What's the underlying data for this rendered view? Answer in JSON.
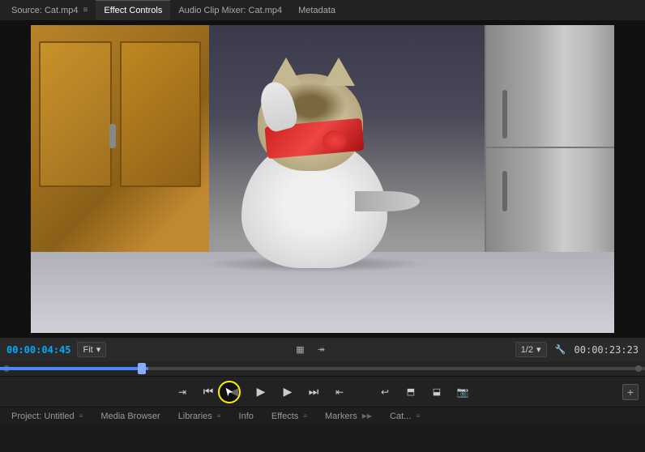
{
  "tabs": {
    "source": {
      "label": "Source: Cat.mp4",
      "menu_icon": "≡"
    },
    "effect_controls": {
      "label": "Effect Controls"
    },
    "audio_mixer": {
      "label": "Audio Clip Mixer: Cat.mp4"
    },
    "metadata": {
      "label": "Metadata"
    }
  },
  "player": {
    "current_time": "00:00:04:45",
    "total_time": "00:00:23:23",
    "fit_label": "Fit",
    "ratio_label": "1/2",
    "fit_arrow": "▾",
    "ratio_arrow": "▾"
  },
  "playback_controls": {
    "step_back_label": "◀◀",
    "frame_back_label": "◀",
    "play_label": "▶",
    "frame_fwd_label": "▶",
    "step_fwd_label": "▶▶",
    "in_point_label": "⇥",
    "out_point_label": "⇤",
    "insert_label": "⬓",
    "overwrite_label": "⬓",
    "export_label": "📷",
    "add_label": "+"
  },
  "bottom_tabs": [
    {
      "label": "Project: Untitled",
      "has_arrow": true
    },
    {
      "label": "Media Browser",
      "has_arrow": true
    },
    {
      "label": "Libraries",
      "has_arrow": true
    },
    {
      "label": "Info",
      "has_arrow": false
    },
    {
      "label": "Effects",
      "has_arrow": true
    },
    {
      "label": "Markers",
      "has_arrow": true
    },
    {
      "label": "Cat...",
      "has_arrow": true
    }
  ],
  "icons": {
    "wrench": "🔧",
    "menu": "≡",
    "arrow_down": "▾"
  }
}
